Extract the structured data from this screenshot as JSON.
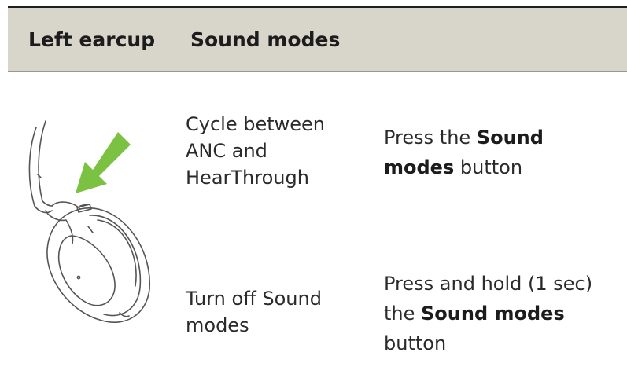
{
  "table": {
    "headers": {
      "left_earcup": "Left earcup",
      "sound_modes": "Sound modes"
    },
    "rows": [
      {
        "action_lines": [
          "Cycle between",
          "ANC and",
          "HearThrough"
        ],
        "instruction": {
          "pre": "Press the ",
          "bold1": "Sound",
          "line2_bold": "modes",
          "post": " button"
        }
      },
      {
        "action_lines": [
          "Turn off Sound",
          "modes"
        ],
        "instruction": {
          "line1": "Press and hold (1 sec)",
          "pre2": "the ",
          "bold2": "Sound modes",
          "line3": "button"
        }
      }
    ]
  },
  "illustration": {
    "icon": "headphone-earcup-icon",
    "arrow_color": "#7cc242",
    "stroke_color": "#555555"
  }
}
